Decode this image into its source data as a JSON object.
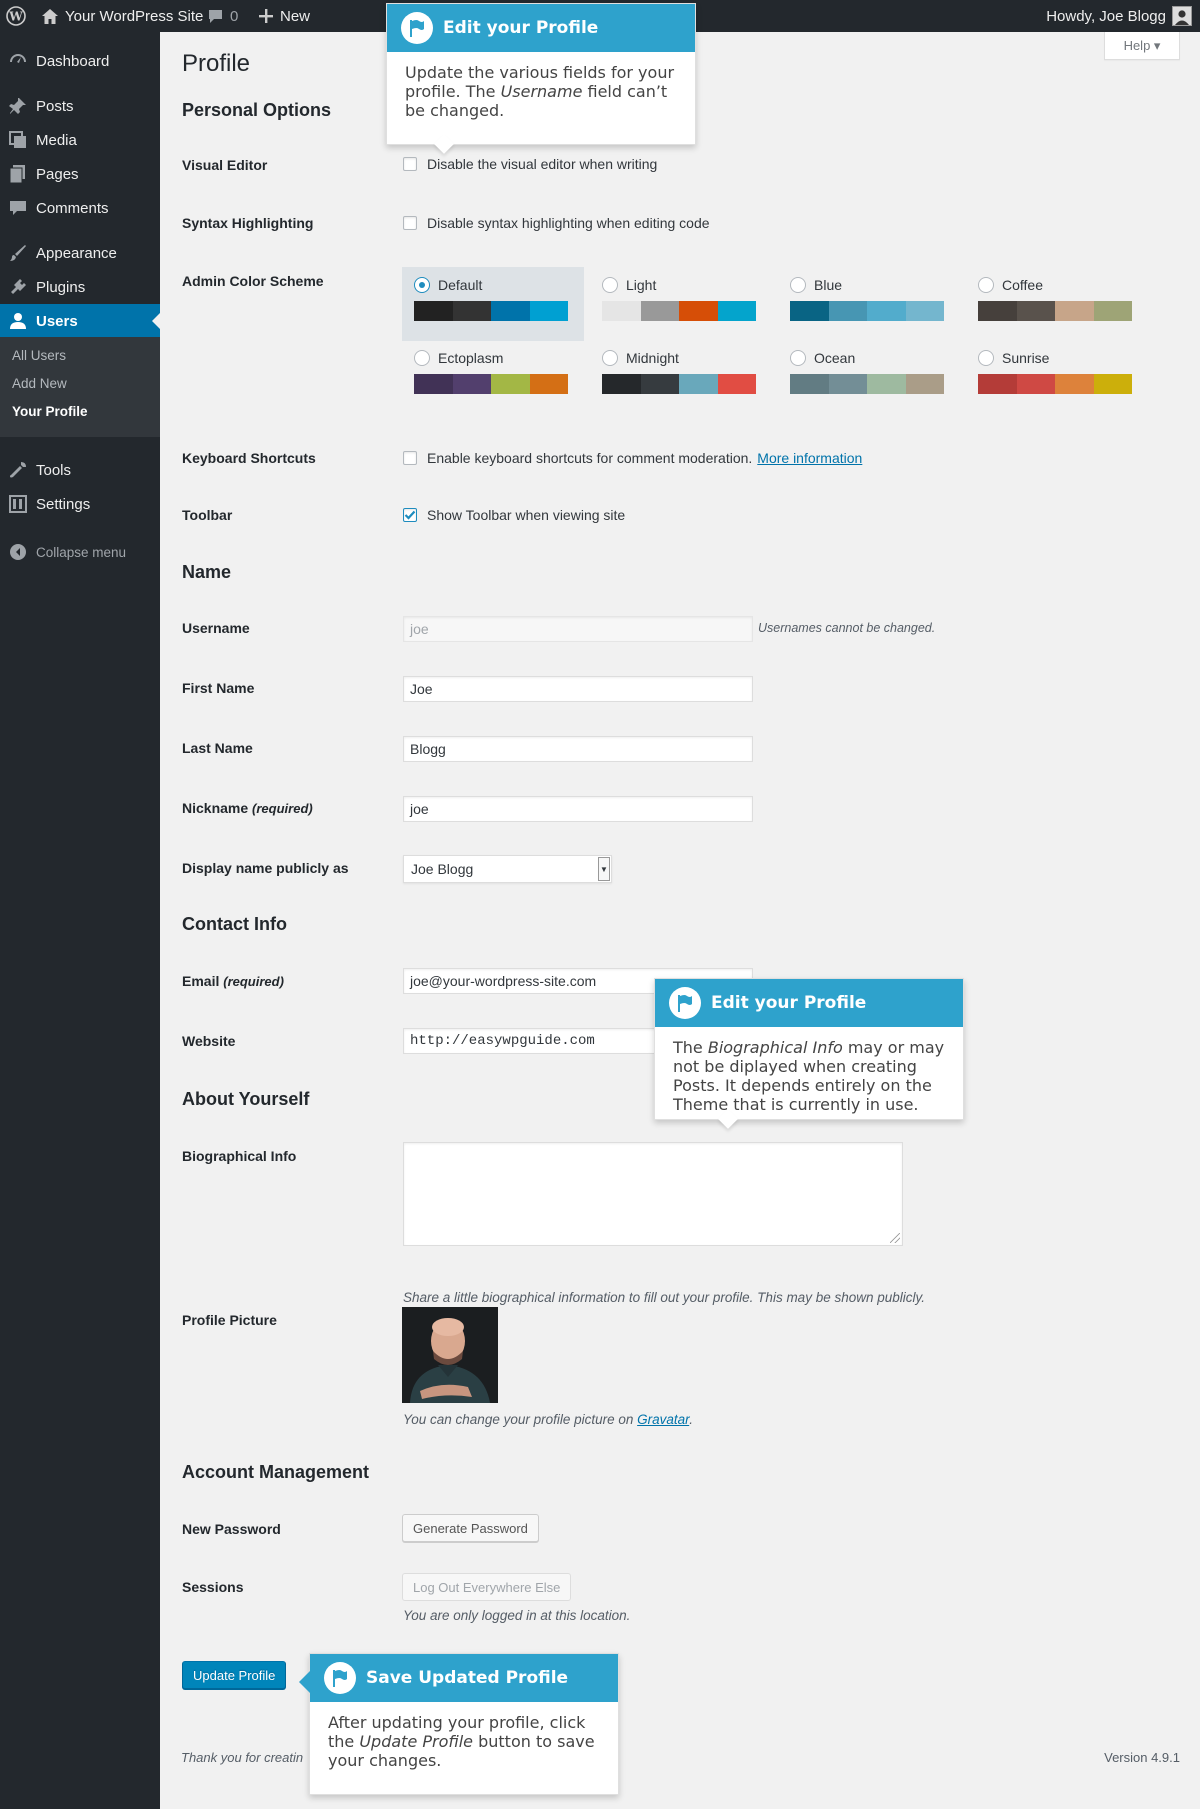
{
  "adminbar": {
    "site_name": "Your WordPress Site",
    "comments_count": "0",
    "new_label": "New",
    "howdy": "Howdy, Joe Blogg"
  },
  "sidebar": {
    "items": [
      {
        "label": "Dashboard",
        "icon": "dashboard-icon"
      },
      {
        "label": "Posts",
        "icon": "pin-icon"
      },
      {
        "label": "Media",
        "icon": "media-icon"
      },
      {
        "label": "Pages",
        "icon": "pages-icon"
      },
      {
        "label": "Comments",
        "icon": "comments-icon"
      },
      {
        "label": "Appearance",
        "icon": "brush-icon"
      },
      {
        "label": "Plugins",
        "icon": "plugin-icon"
      },
      {
        "label": "Users",
        "icon": "users-icon"
      },
      {
        "label": "Tools",
        "icon": "wrench-icon"
      },
      {
        "label": "Settings",
        "icon": "settings-icon"
      }
    ],
    "users_submenu": [
      "All Users",
      "Add New",
      "Your Profile"
    ],
    "collapse_label": "Collapse menu"
  },
  "page": {
    "title": "Profile",
    "help_label": "Help ▾"
  },
  "personal_options": {
    "heading": "Personal Options",
    "visual_editor_label": "Visual Editor",
    "visual_editor_text": "Disable the visual editor when writing",
    "syntax_label": "Syntax Highlighting",
    "syntax_text": "Disable syntax highlighting when editing code",
    "color_scheme_label": "Admin Color Scheme",
    "schemes": [
      {
        "name": "Default",
        "selected": true,
        "colors": [
          "#222222",
          "#333333",
          "#0073aa",
          "#00a0d2"
        ]
      },
      {
        "name": "Light",
        "selected": false,
        "colors": [
          "#e5e5e5",
          "#999999",
          "#d64e07",
          "#04a4cc"
        ]
      },
      {
        "name": "Blue",
        "selected": false,
        "colors": [
          "#096484",
          "#4796b3",
          "#52accc",
          "#74b6ce"
        ]
      },
      {
        "name": "Coffee",
        "selected": false,
        "colors": [
          "#46403c",
          "#59524c",
          "#c7a589",
          "#9ea476"
        ]
      },
      {
        "name": "Ectoplasm",
        "selected": false,
        "colors": [
          "#413256",
          "#523f6d",
          "#a3b745",
          "#d46f15"
        ]
      },
      {
        "name": "Midnight",
        "selected": false,
        "colors": [
          "#25282b",
          "#363b3f",
          "#69a8bb",
          "#e14d43"
        ]
      },
      {
        "name": "Ocean",
        "selected": false,
        "colors": [
          "#627c83",
          "#738e96",
          "#9ebaa0",
          "#aa9d88"
        ]
      },
      {
        "name": "Sunrise",
        "selected": false,
        "colors": [
          "#b43c38",
          "#cf4944",
          "#dd823b",
          "#ccaf0b"
        ]
      }
    ],
    "keyboard_label": "Keyboard Shortcuts",
    "keyboard_text": "Enable keyboard shortcuts for comment moderation.",
    "keyboard_link": "More information",
    "toolbar_label": "Toolbar",
    "toolbar_text": "Show Toolbar when viewing site"
  },
  "name_section": {
    "heading": "Name",
    "username_label": "Username",
    "username_value": "joe",
    "username_note": "Usernames cannot be changed.",
    "first_name_label": "First Name",
    "first_name_value": "Joe",
    "last_name_label": "Last Name",
    "last_name_value": "Blogg",
    "nickname_label": "Nickname",
    "nickname_required": "(required)",
    "nickname_value": "joe",
    "display_label": "Display name publicly as",
    "display_value": "Joe Blogg"
  },
  "contact": {
    "heading": "Contact Info",
    "email_label": "Email",
    "email_required": "(required)",
    "email_value": "joe@your-wordpress-site.com",
    "website_label": "Website",
    "website_value": "http://easywpguide.com"
  },
  "about": {
    "heading": "About Yourself",
    "bio_label": "Biographical Info",
    "bio_desc": "Share a little biographical information to fill out your profile. This may be shown publicly.",
    "picture_label": "Profile Picture",
    "picture_desc_pre": "You can change your profile picture on ",
    "picture_link": "Gravatar",
    "picture_desc_post": "."
  },
  "account": {
    "heading": "Account Management",
    "password_label": "New Password",
    "generate_button": "Generate Password",
    "sessions_label": "Sessions",
    "logout_button": "Log Out Everywhere Else",
    "sessions_desc": "You are only logged in at this location."
  },
  "submit": {
    "update_button": "Update Profile"
  },
  "footer": {
    "thanks": "Thank you for creatin",
    "version": "Version 4.9.1"
  },
  "pointers": {
    "p1_title": "Edit your Profile",
    "p1_a": "Update the various fields for your profile. The ",
    "p1_em": "Username",
    "p1_b": " field can’t be changed.",
    "p2_title": "Edit your Profile",
    "p2_a": "The ",
    "p2_em": "Biographical Info",
    "p2_b": " may or may not be diplayed when creating Posts. It depends entirely on the Theme that is currently in use.",
    "p3_title": "Save Updated Profile",
    "p3_a": "After updating your profile, click the ",
    "p3_em": "Update Profile",
    "p3_b": " button to save your changes."
  }
}
